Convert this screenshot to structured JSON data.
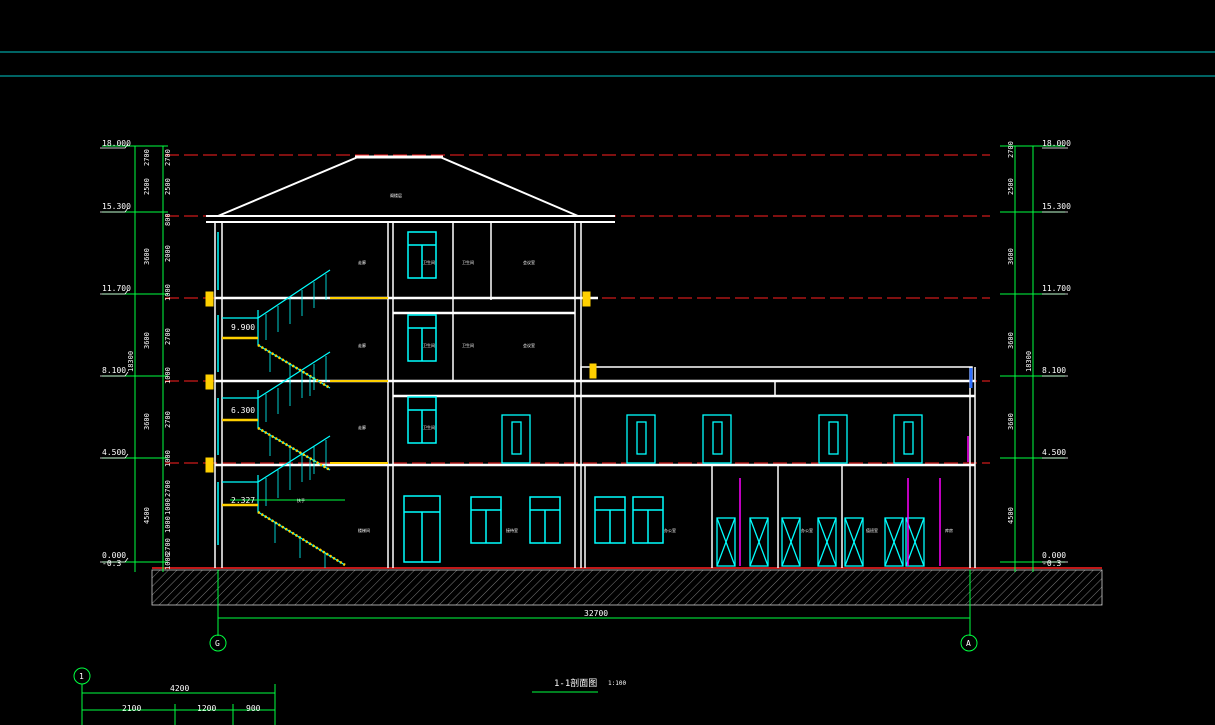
{
  "drawing": {
    "title": "1-1剖面图",
    "scale": "1:100",
    "overall_width": "32700",
    "axis_left": "G",
    "axis_right": "A",
    "detail_axis": "1"
  },
  "colors": {
    "background": "#000000",
    "wall": "#ffffff",
    "elevation_line": "#ff2020",
    "dimension": "#00ff40",
    "cyan": "#00ffff",
    "yellow": "#ffd000",
    "magenta": "#ff00ff"
  },
  "levels": {
    "left": [
      "18.000",
      "15.300",
      "11.700",
      "8.100",
      "4.500",
      "0.000",
      "-0.3"
    ],
    "right": [
      "18.000",
      "15.300",
      "11.700",
      "8.100",
      "4.500",
      "0.000",
      "-0.3"
    ],
    "landings": [
      "9.900",
      "6.300",
      "2.327"
    ]
  },
  "dims": {
    "left_inner": [
      "2700",
      "2500",
      "800",
      "2000",
      "1000",
      "2700",
      "1000",
      "2700",
      "1000",
      "2700",
      "1000",
      "1000",
      "2700",
      "1000"
    ],
    "left_outer": [
      "2700",
      "2500",
      "3600",
      "3600",
      "3600",
      "4500"
    ],
    "left_total": "18300",
    "right_inner": [
      "2700",
      "2500",
      "3600",
      "3600",
      "3600",
      "4500"
    ],
    "right_total": "18300",
    "bottom_total": "4200",
    "bottom_parts": [
      "2100",
      "1200",
      "900"
    ]
  },
  "rooms": {
    "roof": "阁楼层",
    "corridor": [
      "走廊",
      "走廊",
      "走廊",
      "楼梯间"
    ],
    "floor4": [
      "卫生间",
      "卫生间",
      "会议室"
    ],
    "floor3": [
      "卫生间",
      "卫生间",
      "会议室"
    ],
    "floor2": [
      "卫生间"
    ],
    "floor1": [
      "接待室",
      "办公室",
      "办公室",
      "值班室",
      "库房"
    ],
    "stair_note": "扶手"
  }
}
